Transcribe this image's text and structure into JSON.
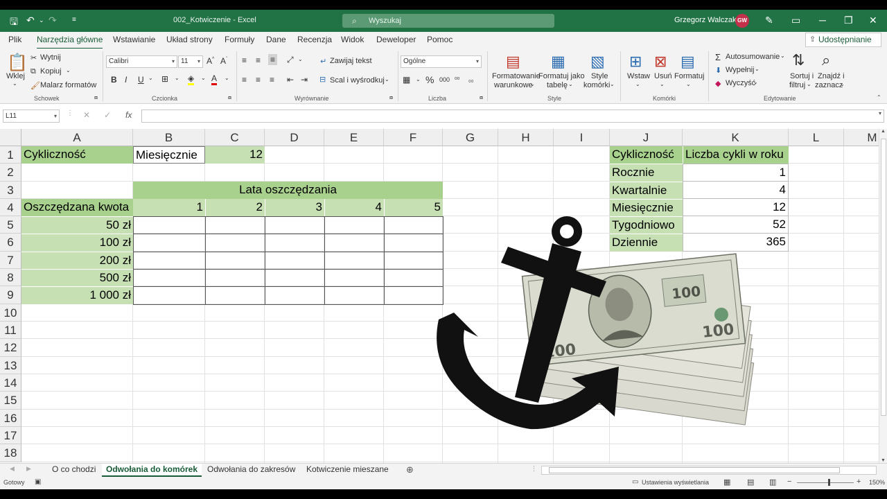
{
  "window": {
    "title": "002_Kotwiczenie  -  Excel",
    "search_placeholder": "Wyszukaj",
    "user_name": "Grzegorz Walczak",
    "user_initials": "GW"
  },
  "menu": {
    "tabs": [
      "Plik",
      "Narzędzia główne",
      "Wstawianie",
      "Układ strony",
      "Formuły",
      "Dane",
      "Recenzja",
      "Widok",
      "Deweloper",
      "Pomoc"
    ],
    "share": "Udostępnianie"
  },
  "ribbon": {
    "clipboard": {
      "paste": "Wklej",
      "cut": "Wytnij",
      "copy": "Kopiuj",
      "painter": "Malarz formatów",
      "group": "Schowek"
    },
    "font": {
      "name": "Calibri",
      "size": "11",
      "bold": "B",
      "italic": "I",
      "underline": "U",
      "group": "Czcionka"
    },
    "alignment": {
      "wrap": "Zawijaj tekst",
      "merge": "Scal i wyśrodkuj",
      "group": "Wyrównanie"
    },
    "number": {
      "format": "Ogólne",
      "group": "Liczba"
    },
    "styles": {
      "cond_1": "Formatowanie",
      "cond_2": "warunkowe",
      "table_1": "Formatuj jako",
      "table_2": "tabelę",
      "cell_1": "Style",
      "cell_2": "komórki",
      "group": "Style"
    },
    "cells": {
      "insert": "Wstaw",
      "delete": "Usuń",
      "format": "Formatuj",
      "group": "Komórki"
    },
    "editing": {
      "autosum": "Autosumowanie",
      "fill": "Wypełnij",
      "clear": "Wyczyść",
      "sort_1": "Sortuj i",
      "sort_2": "filtruj",
      "find_1": "Znajdź i",
      "find_2": "zaznacz",
      "group": "Edytowanie"
    }
  },
  "formula_bar": {
    "name_box": "L11",
    "fx": "fx",
    "formula": ""
  },
  "columns": [
    "A",
    "B",
    "C",
    "D",
    "E",
    "F",
    "G",
    "H",
    "I",
    "J",
    "K",
    "L",
    "M"
  ],
  "rows": [
    "1",
    "2",
    "3",
    "4",
    "5",
    "6",
    "7",
    "8",
    "9",
    "10",
    "11",
    "12",
    "13",
    "14",
    "15",
    "16",
    "17",
    "18"
  ],
  "cells": {
    "A1": "Cykliczność",
    "B1": "Miesięcznie",
    "C1": "12",
    "B3": "Lata oszczędzania",
    "A4": "Oszczędzana kwota",
    "B4": "1",
    "C4": "2",
    "D4": "3",
    "E4": "4",
    "F4": "5",
    "A5": "50 zł",
    "A6": "100 zł",
    "A7": "200 zł",
    "A8": "500 zł",
    "A9": "1 000 zł",
    "J1": "Cykliczność",
    "K1": "Liczba cykli w roku",
    "J2": "Rocznie",
    "K2": "1",
    "J3": "Kwartalnie",
    "K3": "4",
    "J4": "Miesięcznie",
    "K4": "12",
    "J5": "Tygodniowo",
    "K5": "52",
    "J6": "Dziennie",
    "K6": "365"
  },
  "sheets": [
    "O co chodzi",
    "Odwołania do komórek",
    "Odwołania do zakresów",
    "Kotwiczenie mieszane"
  ],
  "status": {
    "ready": "Gotowy",
    "display": "Ustawienia wyświetlania",
    "zoom": "150%"
  },
  "image_note_money": "100"
}
